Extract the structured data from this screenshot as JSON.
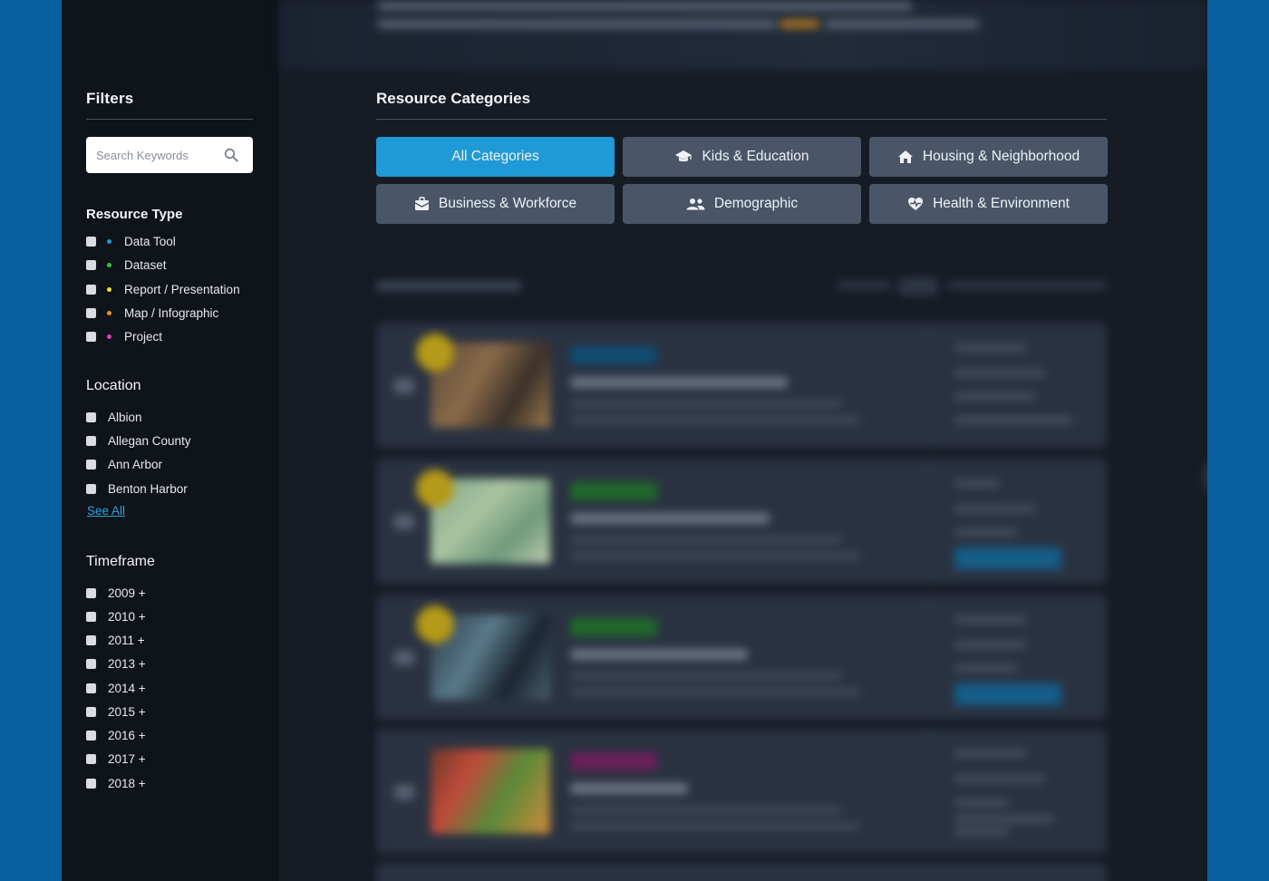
{
  "filters": {
    "title": "Filters",
    "search_placeholder": "Search Keywords",
    "resource_type": {
      "title": "Resource Type",
      "items": [
        {
          "label": "Data Tool",
          "color": "#1e9ad6"
        },
        {
          "label": "Dataset",
          "color": "#2ecc40"
        },
        {
          "label": "Report / Presentation",
          "color": "#f1e21b"
        },
        {
          "label": "Map / Infographic",
          "color": "#f28c1a"
        },
        {
          "label": "Project",
          "color": "#e13bb5"
        }
      ]
    },
    "location": {
      "title": "Location",
      "items": [
        "Albion",
        "Allegan County",
        "Ann Arbor",
        "Benton Harbor"
      ],
      "see_all": "See All"
    },
    "timeframe": {
      "title": "Timeframe",
      "items": [
        "2009 +",
        "2010 +",
        "2011 +",
        "2013 +",
        "2014 +",
        "2015 +",
        "2016 +",
        "2017 +",
        "2018 +"
      ]
    }
  },
  "categories": {
    "title": "Resource Categories",
    "buttons": [
      {
        "label": "All Categories",
        "icon": "none",
        "active": true
      },
      {
        "label": "Kids & Education",
        "icon": "graduation-cap-icon",
        "active": false
      },
      {
        "label": "Housing & Neighborhood",
        "icon": "home-icon",
        "active": false
      },
      {
        "label": "Business & Workforce",
        "icon": "briefcase-icon",
        "active": false
      },
      {
        "label": "Demographic",
        "icon": "people-icon",
        "active": false
      },
      {
        "label": "Health & Environment",
        "icon": "heart-pulse-icon",
        "active": false
      }
    ]
  },
  "colors": {
    "accent": "#1f9ad6",
    "button_bg": "#4b5568",
    "sidebar_bg": "#0f131a",
    "outer_bg": "#0a5fa0"
  }
}
